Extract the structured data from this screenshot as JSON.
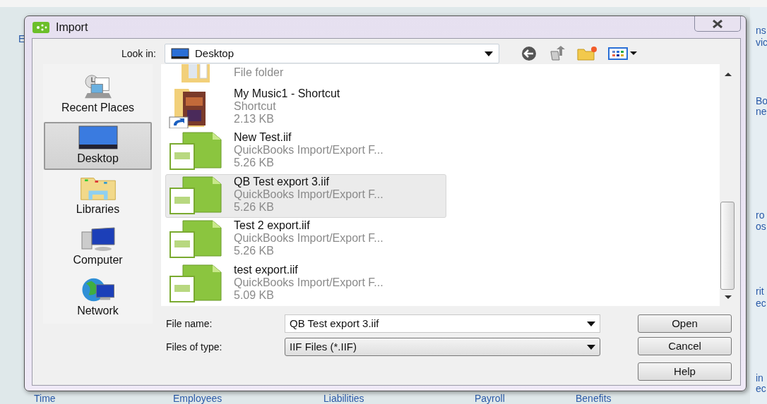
{
  "background": {
    "bottom_labels": [
      "Time",
      "Employees",
      "Liabilities",
      "Payroll",
      "Benefits"
    ],
    "side_labels": [
      "ns",
      "vic",
      "Bo",
      "ne",
      "ro",
      "os",
      "rit",
      "ec",
      "in",
      "ec"
    ],
    "left_label": "E"
  },
  "window": {
    "title": "Import"
  },
  "look_in": {
    "label": "Look in:",
    "value": "Desktop"
  },
  "places": [
    {
      "label": "Recent Places",
      "kind": "recent",
      "selected": false
    },
    {
      "label": "Desktop",
      "kind": "desktop",
      "selected": true
    },
    {
      "label": "Libraries",
      "kind": "libraries",
      "selected": false
    },
    {
      "label": "Computer",
      "kind": "computer",
      "selected": false
    },
    {
      "label": "Network",
      "kind": "network",
      "selected": false
    }
  ],
  "files": [
    {
      "kind": "folder",
      "lines": [
        "File folder"
      ],
      "selected": false
    },
    {
      "kind": "shortcut",
      "name": "My Music1 - Shortcut",
      "lines": [
        "Shortcut",
        "2.13 KB"
      ],
      "selected": false
    },
    {
      "kind": "iif",
      "name": "New Test.iif",
      "lines": [
        "QuickBooks Import/Export F...",
        "5.26 KB"
      ],
      "selected": false
    },
    {
      "kind": "iif",
      "name": "QB Test export 3.iif",
      "lines": [
        "QuickBooks Import/Export F...",
        "5.26 KB"
      ],
      "selected": true
    },
    {
      "kind": "iif",
      "name": "Test 2 export.iif",
      "lines": [
        "QuickBooks Import/Export F...",
        "5.26 KB"
      ],
      "selected": false
    },
    {
      "kind": "iif",
      "name": "test export.iif",
      "lines": [
        "QuickBooks Import/Export F...",
        "5.09 KB"
      ],
      "selected": false
    }
  ],
  "file_name": {
    "label": "File name:",
    "value": "QB Test export 3.iif"
  },
  "file_type": {
    "label": "Files of type:",
    "value": "IIF Files (*.IIF)"
  },
  "buttons": [
    "Open",
    "Cancel",
    "Help"
  ]
}
